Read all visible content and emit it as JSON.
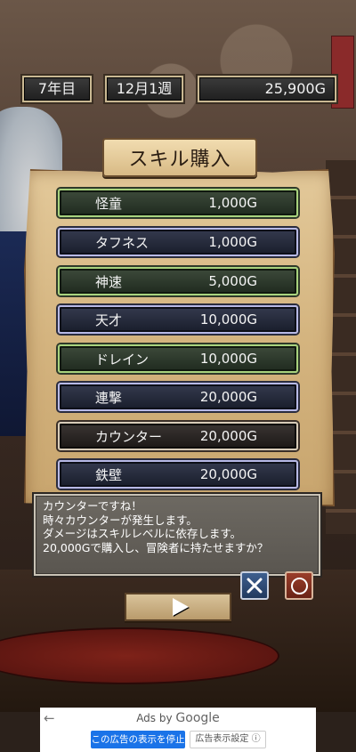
{
  "status": {
    "year": "7年目",
    "week": "12月1週",
    "gold": "25,900G"
  },
  "title": "スキル購入",
  "skills": [
    {
      "name": "怪童",
      "price": "1,000G",
      "frame": "green"
    },
    {
      "name": "タフネス",
      "price": "1,000G",
      "frame": "blue"
    },
    {
      "name": "神速",
      "price": "5,000G",
      "frame": "green"
    },
    {
      "name": "天才",
      "price": "10,000G",
      "frame": "blue"
    },
    {
      "name": "ドレイン",
      "price": "10,000G",
      "frame": "green"
    },
    {
      "name": "連撃",
      "price": "20,000G",
      "frame": "blue"
    },
    {
      "name": "カウンター",
      "price": "20,000G",
      "frame": "dark"
    },
    {
      "name": "鉄壁",
      "price": "20,000G",
      "frame": "blue"
    }
  ],
  "dialog": {
    "lines": [
      "カウンターですね！",
      "時々カウンターが発生します。",
      "ダメージはスキルレベルに依存します。",
      "20,000Gで購入し、冒険者に持たせますか？"
    ]
  },
  "buttons": {
    "cancel_icon": "x-icon",
    "confirm_icon": "circle-icon",
    "next_icon": "play-arrow-icon"
  },
  "ad": {
    "back_icon": "back-arrow-icon",
    "ads_by": "Ads by",
    "brand": "Google",
    "stop_label": "この広告の表示を停止",
    "settings_label": "広告表示設定 ⓘ"
  },
  "colors": {
    "frame_green": "#a8d37e",
    "frame_blue": "#b7b9e6",
    "frame_dark": "#d7cbb8",
    "parchment": "#d4b47f",
    "ad_button": "#1a73e8"
  }
}
